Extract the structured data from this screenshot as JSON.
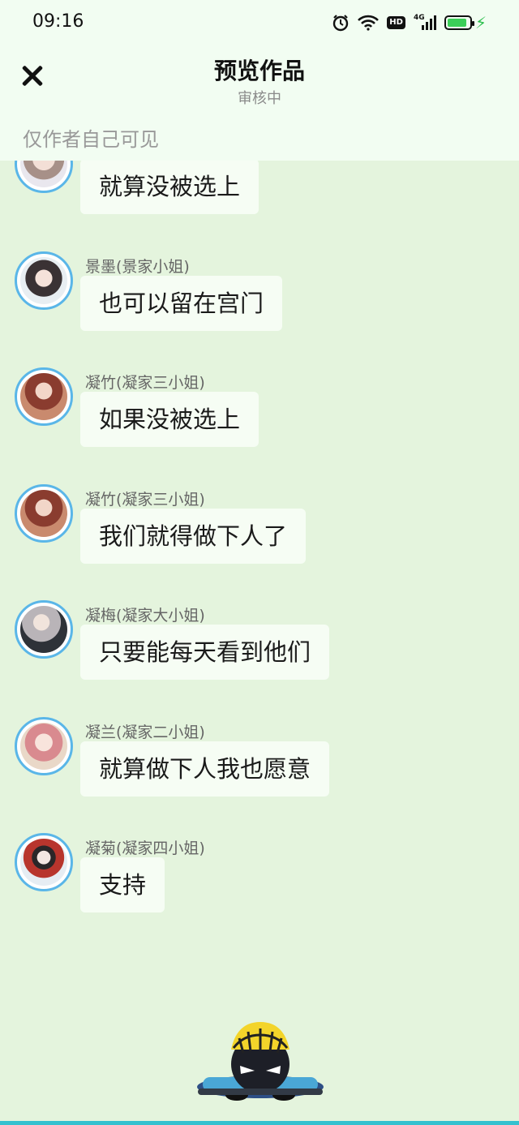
{
  "status_bar": {
    "time": "09:16",
    "network": "4G",
    "hd": "HD",
    "battery_level": 0.9,
    "icons": [
      "alarm-icon",
      "wifi-icon",
      "hd-icon",
      "signal-icon",
      "battery-icon",
      "charging-icon"
    ]
  },
  "header": {
    "title": "预览作品",
    "subtitle": "审核中",
    "visibility_note": "仅作者自己可见",
    "close_icon": "close-icon"
  },
  "colors": {
    "background": "#e4f4dd",
    "header_bg": "#f2fdf2",
    "bubble_bg": "#f6fdf4",
    "avatar_border": "#5ab6e8",
    "accent_line": "#33c1cf"
  },
  "messages": [
    {
      "name": "",
      "text": "就算没被选上"
    },
    {
      "name": "景墨(景家小姐)",
      "text": "也可以留在宫门"
    },
    {
      "name": "凝竹(凝家三小姐)",
      "text": "如果没被选上"
    },
    {
      "name": "凝竹(凝家三小姐)",
      "text": "我们就得做下人了"
    },
    {
      "name": "凝梅(凝家大小姐)",
      "text": "只要能每天看到他们"
    },
    {
      "name": "凝兰(凝家二小姐)",
      "text": "就算做下人我也愿意"
    },
    {
      "name": "凝菊(凝家四小姐)",
      "text": "支持"
    }
  ]
}
